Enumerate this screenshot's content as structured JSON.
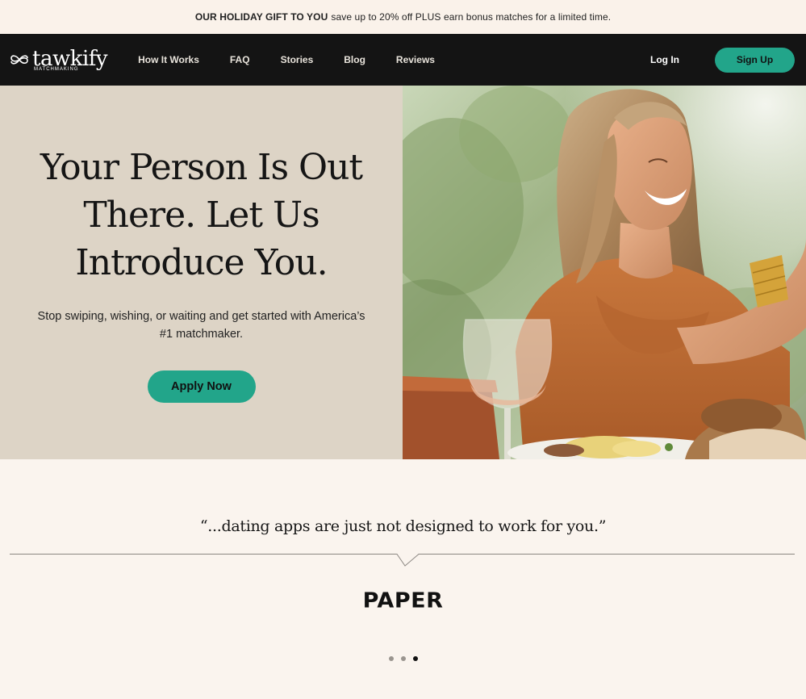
{
  "promo": {
    "bold": "OUR HOLIDAY GIFT TO YOU",
    "text": "save up to 20% off PLUS earn bonus matches for a limited time."
  },
  "nav": {
    "logo_word": "tawkify",
    "logo_sub": "MATCHMAKING",
    "links": [
      "How It Works",
      "FAQ",
      "Stories",
      "Blog",
      "Reviews"
    ],
    "login": "Log In",
    "signup": "Sign Up"
  },
  "hero": {
    "title": "Your Person Is Out There. Let Us Introduce You.",
    "subtitle": "Stop swiping, wishing, or waiting and get started with America’s #1 matchmaker.",
    "cta": "Apply Now"
  },
  "press": {
    "quote": "“...dating apps are just not designed to work for you.”",
    "brand": "PAPER",
    "active_slide": 3,
    "slide_count": 3
  },
  "colors": {
    "accent": "#22a58a",
    "nav_bg": "#141414",
    "hero_bg": "#ddd4c6",
    "page_bg": "#faf4ee"
  }
}
